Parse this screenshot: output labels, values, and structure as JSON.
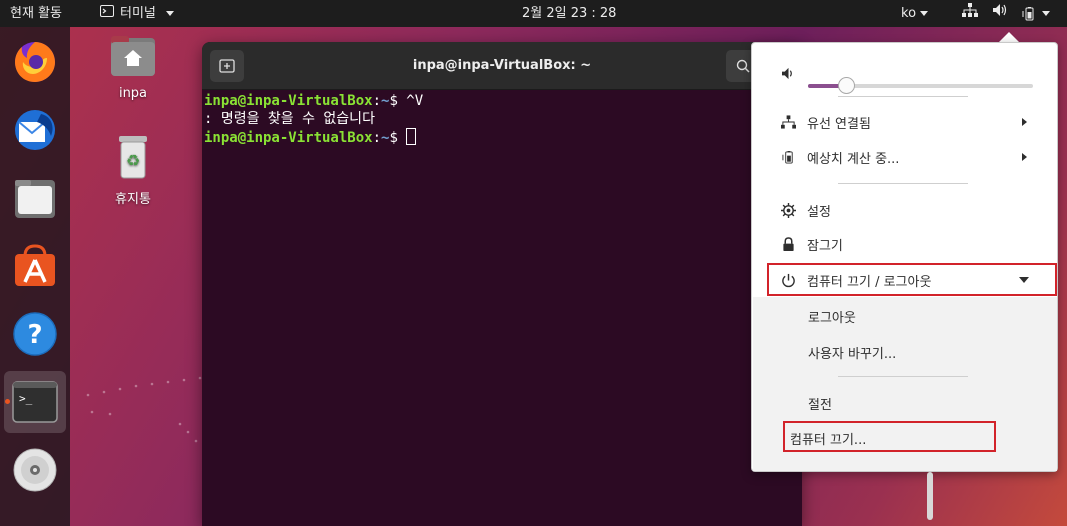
{
  "topbar": {
    "activities": "현재 활동",
    "app_name": "터미널",
    "clock": "2월 2일  23 : 28",
    "language": "ko"
  },
  "dock": {
    "items": [
      {
        "name": "firefox-icon"
      },
      {
        "name": "thunderbird-icon"
      },
      {
        "name": "files-icon"
      },
      {
        "name": "software-icon"
      },
      {
        "name": "help-icon"
      },
      {
        "name": "terminal-icon",
        "active": true
      },
      {
        "name": "disc-icon"
      }
    ]
  },
  "desktop": {
    "home_label": "inpa",
    "trash_label": "휴지통"
  },
  "terminal": {
    "title": "inpa@inpa-VirtualBox: ~",
    "lines": [
      {
        "user": "inpa@inpa-VirtualBox",
        "path": "~",
        "cmd": "$ ^V"
      },
      {
        "output": ": 명령을 찾을 수 없습니다"
      },
      {
        "user": "inpa@inpa-VirtualBox",
        "path": "~",
        "cmd": "$ "
      }
    ]
  },
  "system_menu": {
    "volume_level": 0.17,
    "wired": "유선 연결됨",
    "battery": "예상치 계산 중...",
    "settings": "설정",
    "lock": "잠그기",
    "power_off_logout": "컴퓨터 끄기 / 로그아웃",
    "logout": "로그아웃",
    "switch_user": "사용자 바꾸기...",
    "suspend": "절전",
    "power_off": "컴퓨터 끄기...",
    "accent_color": "#8b4f8f",
    "highlight_color": "#d2232a"
  }
}
